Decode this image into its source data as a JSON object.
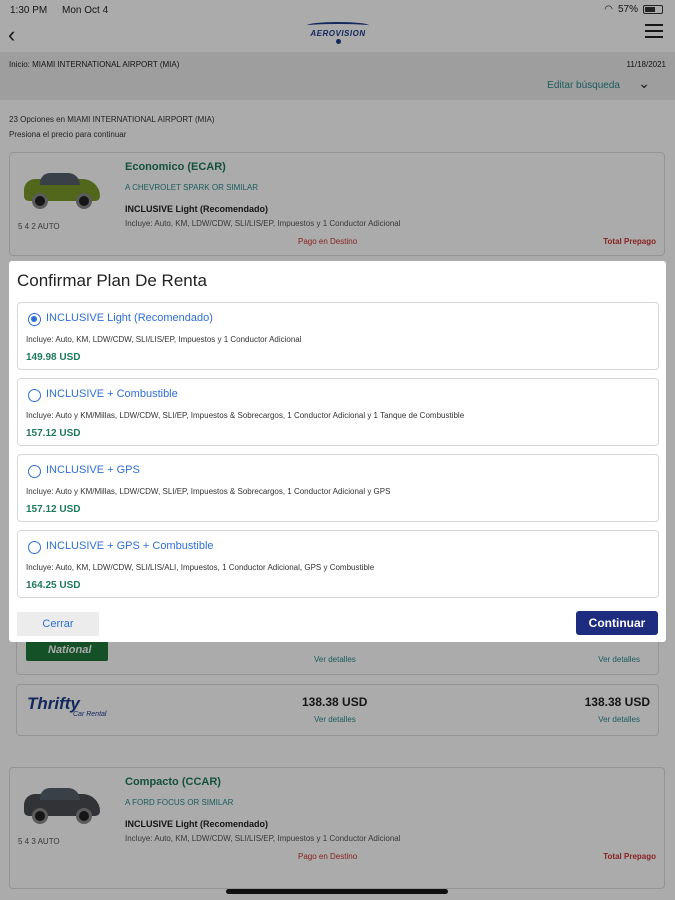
{
  "status_bar": {
    "time": "1:30 PM",
    "date": "Mon Oct 4",
    "battery": "57%"
  },
  "header": {
    "back_icon": "chevron-left-icon",
    "logo_text": "AEROVISION",
    "menu_icon": "hamburger-menu-icon"
  },
  "trip": {
    "origin": "Inicio: MIAMI INTERNATIONAL AIRPORT (MIA)",
    "date": "11/18/2021",
    "edit_label": "Editar búsqueda"
  },
  "results": {
    "count_text": "23 Opciones en MIAMI INTERNATIONAL AIRPORT (MIA)",
    "hint": "Presiona el precio para continuar"
  },
  "cars": [
    {
      "category": "Economico (ECAR)",
      "similar": "A CHEVROLET SPARK OR SIMILAR",
      "plan": "INCLUSIVE Light (Recomendado)",
      "includes": "Incluye: Auto, KM, LDW/CDW, SLI/LIS/EP, Impuestos y 1 Conductor Adicional",
      "specs": "5  4  2  AUTO",
      "pay_destination": "Pago en Destino",
      "prepay": "Total Prepago",
      "color": "#7d9a2a"
    },
    {
      "category": "Compacto (CCAR)",
      "similar": "A FORD FOCUS OR SIMILAR",
      "plan": "INCLUSIVE Light (Recomendado)",
      "includes": "Incluye: Auto, KM, LDW/CDW, SLI/LIS/EP, Impuestos y 1 Conductor Adicional",
      "specs": "5  4  3  AUTO",
      "pay_destination": "Pago en Destino",
      "prepay": "Total Prepago",
      "color": "#4a4d52"
    }
  ],
  "offers": [
    {
      "brand": "National",
      "details": "Ver detalles",
      "details_2": "Ver detalles"
    },
    {
      "brand": "Thrifty",
      "brand_sub": "Car Rental",
      "price": "138.38 USD",
      "price_2": "138.38 USD",
      "details": "Ver detalles",
      "details_2": "Ver detalles"
    }
  ],
  "modal": {
    "title": "Confirmar Plan De Renta",
    "options": [
      {
        "name": "INCLUSIVE Light (Recomendado)",
        "desc": "Incluye: Auto, KM, LDW/CDW, SLI/LIS/EP, Impuestos y 1 Conductor Adicional",
        "price": "149.98 USD",
        "selected": true
      },
      {
        "name": "INCLUSIVE + Combustible",
        "desc": "Incluye: Auto y KM/Millas, LDW/CDW, SLI/EP, Impuestos & Sobrecargos, 1 Conductor Adicional y 1 Tanque de Combustible",
        "price": "157.12 USD",
        "selected": false
      },
      {
        "name": "INCLUSIVE + GPS",
        "desc": "Incluye: Auto y KM/Millas, LDW/CDW, SLI/EP, Impuestos & Sobrecargos, 1 Conductor Adicional y GPS",
        "price": "157.12 USD",
        "selected": false
      },
      {
        "name": "INCLUSIVE + GPS + Combustible",
        "desc": "Incluye: Auto, KM, LDW/CDW, SLI/LIS/ALI, Impuestos, 1 Conductor Adicional, GPS y Combustible",
        "price": "164.25 USD",
        "selected": false
      }
    ],
    "close_label": "Cerrar",
    "continue_label": "Continuar"
  },
  "colors": {
    "accent": "#2f6fd6",
    "brand_dark": "#1e2c80",
    "price_green": "#1e7a5a",
    "alert_red": "#cc3333"
  }
}
